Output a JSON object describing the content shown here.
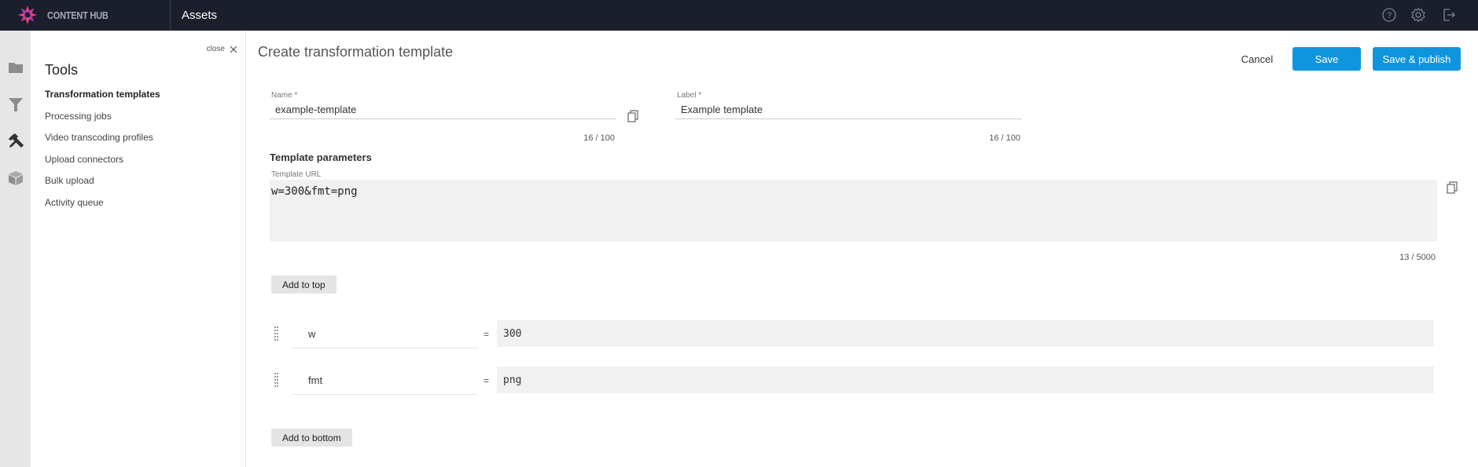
{
  "topbar": {
    "brand": "CONTENT HUB",
    "section": "Assets",
    "icons": [
      "help-icon",
      "settings-icon",
      "logout-icon"
    ]
  },
  "rail": {
    "icons": [
      {
        "name": "folder-icon",
        "active": false
      },
      {
        "name": "filter-icon",
        "active": false
      },
      {
        "name": "tools-icon",
        "active": true
      },
      {
        "name": "package-icon",
        "active": false
      }
    ]
  },
  "tools_panel": {
    "close_label": "close",
    "title": "Tools",
    "items": [
      {
        "label": "Transformation templates",
        "active": true
      },
      {
        "label": "Processing jobs",
        "active": false
      },
      {
        "label": "Video transcoding profiles",
        "active": false
      },
      {
        "label": "Upload connectors",
        "active": false
      },
      {
        "label": "Bulk upload",
        "active": false
      },
      {
        "label": "Activity queue",
        "active": false
      }
    ]
  },
  "main": {
    "title": "Create transformation template",
    "actions": {
      "cancel": "Cancel",
      "save": "Save",
      "save_publish": "Save & publish"
    },
    "name_field": {
      "label": "Name *",
      "value": "example-template",
      "counter": "16 / 100"
    },
    "label_field": {
      "label": "Label *",
      "value": "Example template",
      "counter": "16 / 100"
    },
    "params_heading": "Template parameters",
    "url_field": {
      "label": "Template URL",
      "value": "w=300&fmt=png",
      "counter": "13 / 5000"
    },
    "add_top": "Add to top",
    "add_bottom": "Add to bottom",
    "params": [
      {
        "key": "w",
        "eq": "=",
        "value": "300"
      },
      {
        "key": "fmt",
        "eq": "=",
        "value": "png"
      }
    ]
  },
  "colors": {
    "topbar_bg": "#1b1f2b",
    "primary": "#0f95de",
    "rail_bg": "#e6e6e6",
    "logo_accent": "#e83e8c"
  }
}
